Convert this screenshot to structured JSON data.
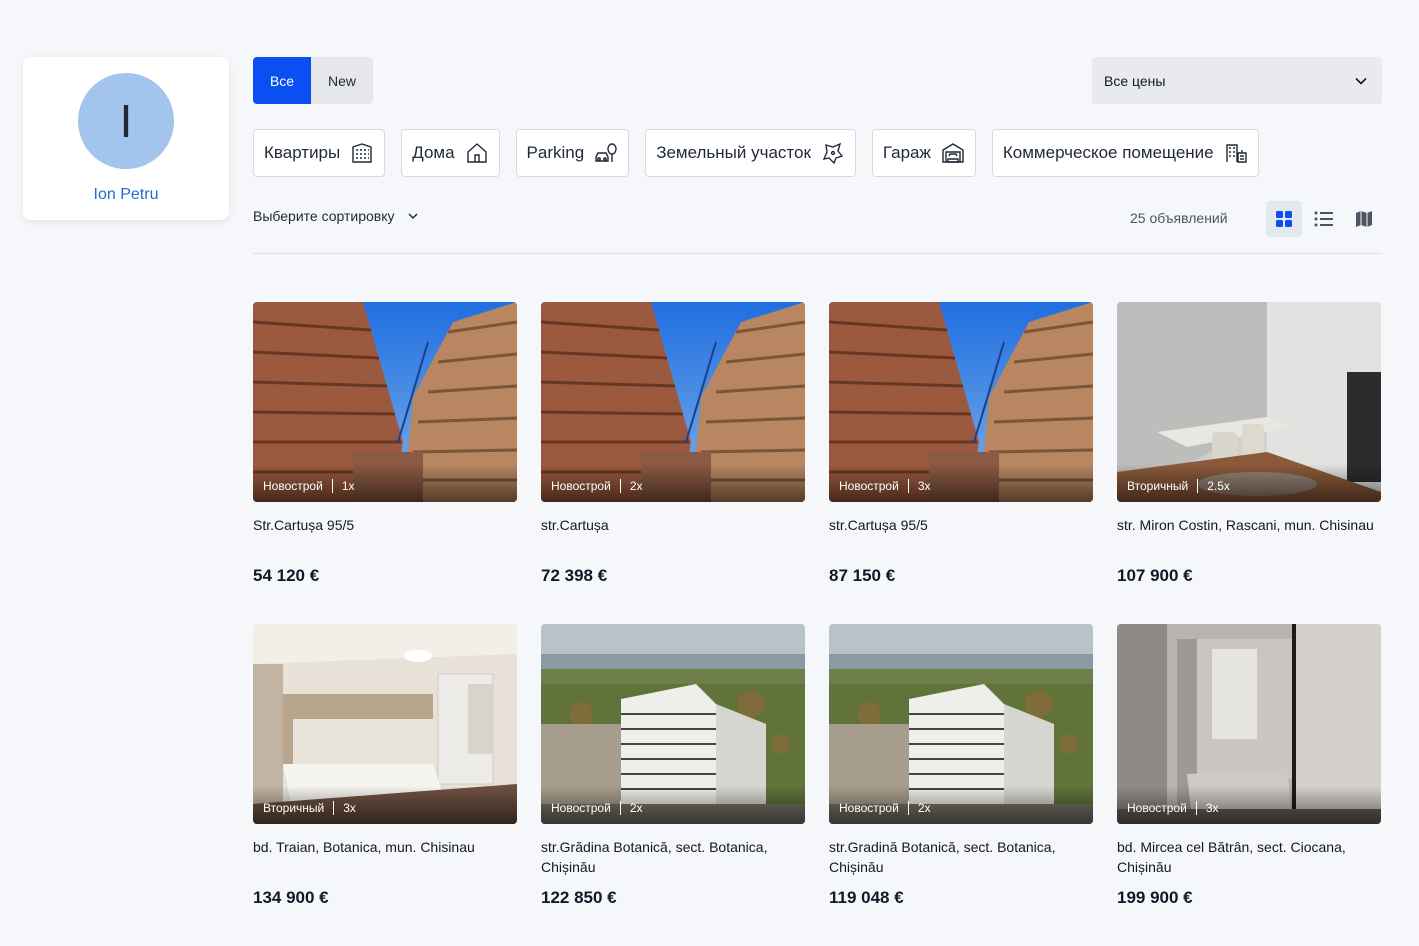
{
  "profile": {
    "initial": "I",
    "name": "Ion Petru"
  },
  "filter_tabs": [
    {
      "label": "Все",
      "active": true
    },
    {
      "label": "New",
      "active": false
    }
  ],
  "price_filter": {
    "value": "Все цены"
  },
  "categories": [
    {
      "label": "Квартиры",
      "icon": "apartment-building-icon"
    },
    {
      "label": "Дома",
      "icon": "house-icon"
    },
    {
      "label": "Parking",
      "icon": "car-tree-icon"
    },
    {
      "label": "Земельный участок",
      "icon": "land-plot-icon"
    },
    {
      "label": "Гараж",
      "icon": "garage-icon"
    },
    {
      "label": "Коммерческое помещение",
      "icon": "commercial-space-icon"
    }
  ],
  "sort": {
    "label": "Выберите сортировку"
  },
  "listing_count": "25 объявлений",
  "views": [
    "grid-view-icon",
    "list-view-icon",
    "map-view-icon"
  ],
  "colors": {
    "accent": "#0a4ff2",
    "link": "#1f6fd6",
    "avatar": "#a3c4ec"
  },
  "listings": [
    {
      "type": "Новострой",
      "rooms": "1x",
      "address": "Str.Cartușa 95/5",
      "price": "54 120 €",
      "photo": "construction"
    },
    {
      "type": "Новострой",
      "rooms": "2x",
      "address": "str.Cartușa",
      "price": "72 398 €",
      "photo": "construction"
    },
    {
      "type": "Новострой",
      "rooms": "3x",
      "address": "str.Cartușa 95/5",
      "price": "87 150 €",
      "photo": "construction"
    },
    {
      "type": "Вторичный",
      "rooms": "2.5x",
      "address": "str. Miron Costin, Rascani, mun. Chisinau",
      "price": "107 900 €",
      "photo": "interior-desk"
    },
    {
      "type": "Вторичный",
      "rooms": "3x",
      "address": "bd. Traian, Botanica, mun. Chisinau",
      "price": "134 900 €",
      "photo": "bedroom"
    },
    {
      "type": "Новострой",
      "rooms": "2x",
      "address": "str.Grădina Botanică, sect. Botanica, Chișinău",
      "price": "122 850 €",
      "photo": "aerial"
    },
    {
      "type": "Новострой",
      "rooms": "2x",
      "address": "str.Gradină Botanică, sect. Botanica, Chișinău",
      "price": "119 048 €",
      "photo": "aerial"
    },
    {
      "type": "Новострой",
      "rooms": "3x",
      "address": "bd. Mircea cel Bătrân, sect. Ciocana, Chișinău",
      "price": "199 900 €",
      "photo": "bedroom-dark"
    }
  ]
}
